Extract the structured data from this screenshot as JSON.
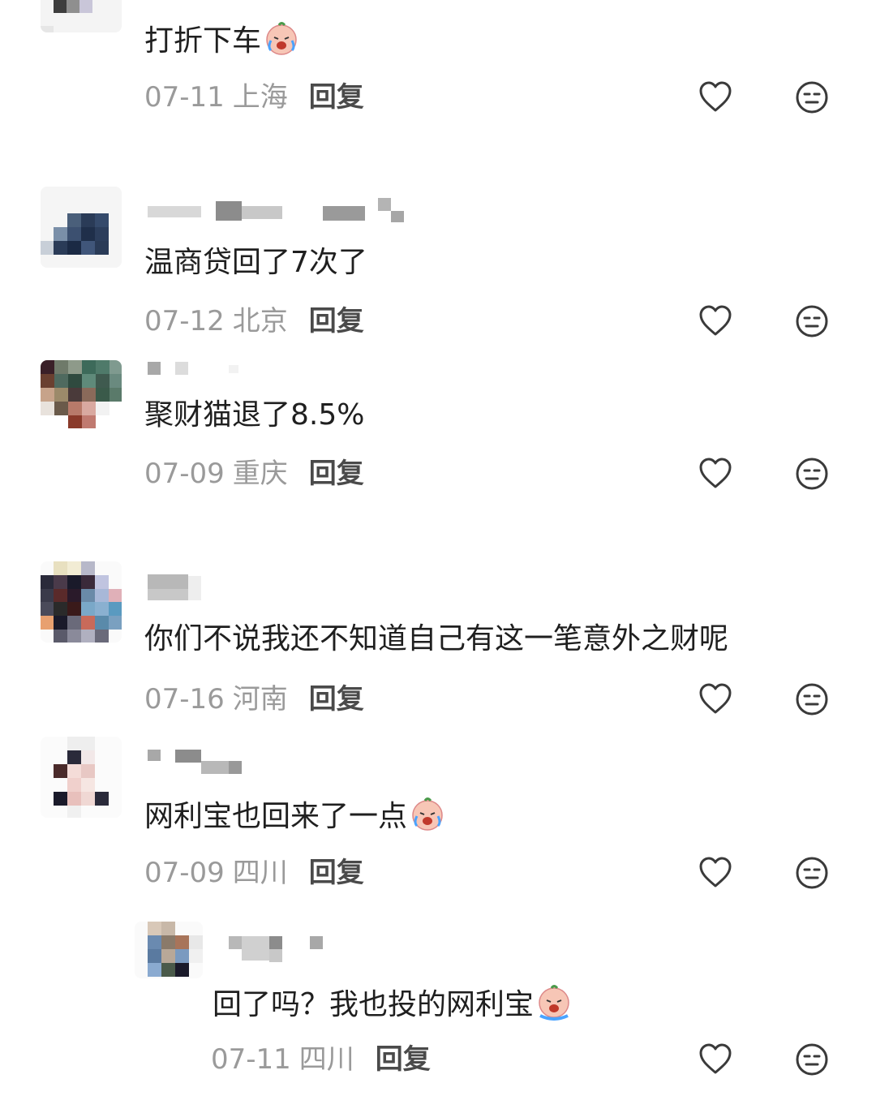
{
  "comments": [
    {
      "text": "打折下车",
      "date": "07-11",
      "location": "上海",
      "reply": "回复"
    },
    {
      "text": "温商贷回了7次了",
      "date": "07-12",
      "location": "北京",
      "reply": "回复"
    },
    {
      "text": "聚财猫退了8.5%",
      "date": "07-09",
      "location": "重庆",
      "reply": "回复"
    },
    {
      "text": "你们不说我还不知道自己有这一笔意外之财呢",
      "date": "07-16",
      "location": "河南",
      "reply": "回复"
    },
    {
      "text": "网利宝也回来了一点",
      "date": "07-09",
      "location": "四川",
      "reply": "回复"
    },
    {
      "text": "回了吗？我也投的网利宝",
      "date": "07-11",
      "location": "四川",
      "reply": "回复"
    }
  ],
  "icons": {
    "like": "heart-outline-icon",
    "dislike": "neutral-face-icon",
    "emoji": "crying-face-emoji"
  },
  "colors": {
    "meta": "#9a9a9a",
    "reply": "#4a4a4a",
    "icon_stroke": "#3a3a3a"
  }
}
